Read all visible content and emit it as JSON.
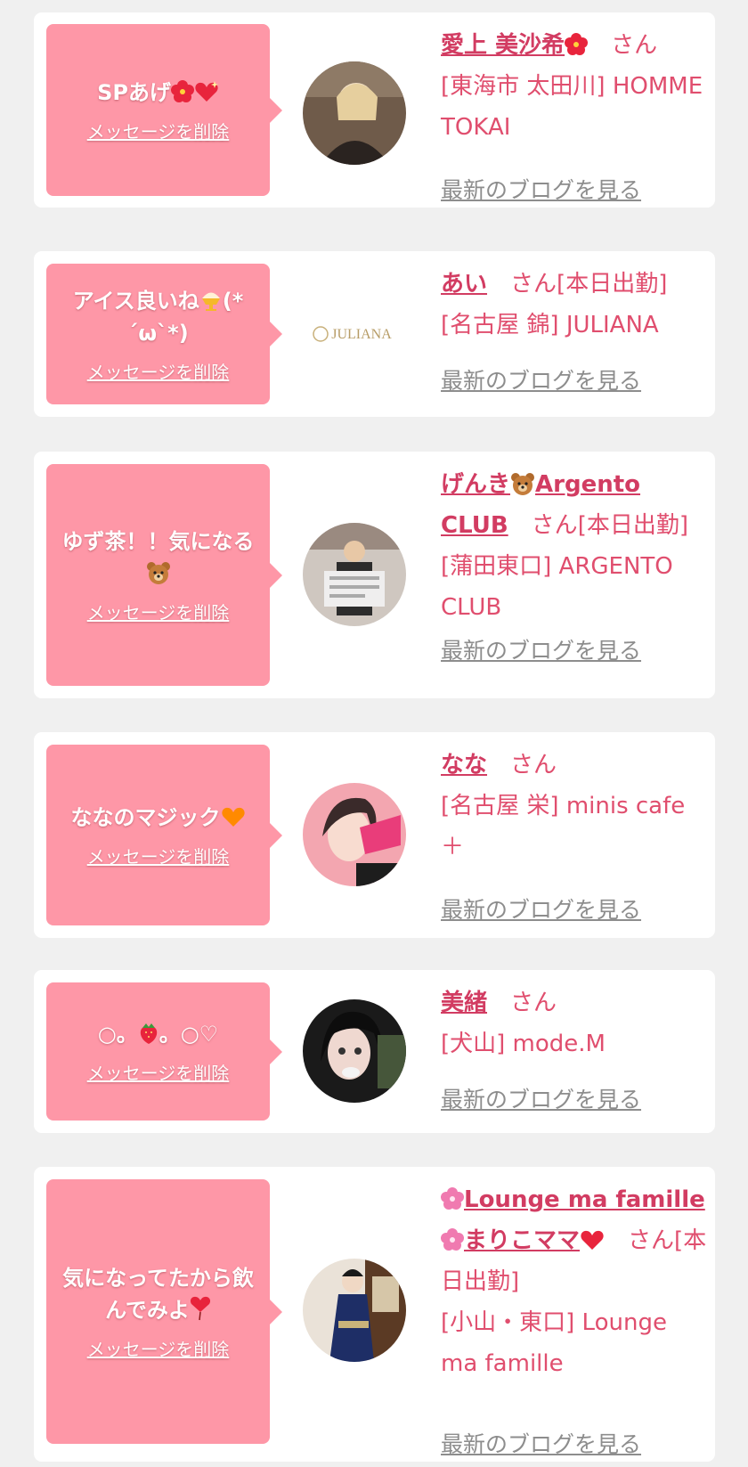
{
  "colors": {
    "bubble": "#fe97a7",
    "accent": "#e04e6e",
    "link_gray": "#8d8d8d",
    "background": "#f0f0f0"
  },
  "entries": [
    {
      "message": "SPあげ",
      "message_icons": [
        "hibiscus-icon",
        "sparkling-heart-icon"
      ],
      "delete_label": "メッセージを削除",
      "name": "愛上 美沙希",
      "name_icons": [
        "hibiscus-icon"
      ],
      "honorific": "さん",
      "status": "",
      "shop": "[東海市 太田川] HOMME TOKAI",
      "blog_label": "最新のブログを見る",
      "avatar": "photo-avatar-blonde-woman"
    },
    {
      "message": "アイス良いね",
      "message_suffix": "(*´ω`*)",
      "message_icons": [
        "ice-cream-icon"
      ],
      "delete_label": "メッセージを削除",
      "name": "あい",
      "name_icons": [],
      "honorific": "さん",
      "status": "[本日出勤]",
      "shop": "[名古屋 錦] JULIANA",
      "blog_label": "最新のブログを見る",
      "avatar": "logo-avatar",
      "avatar_text": "JULIANA"
    },
    {
      "message": "ゆず茶！！気になる",
      "message_icons": [
        "bear-icon"
      ],
      "delete_label": "メッセージを削除",
      "name_prefix": "げんき",
      "name_suffix": "Argento CLUB",
      "name_icons": [
        "bear-icon"
      ],
      "honorific": "さん",
      "status": "[本日出勤]",
      "shop": "[蒲田東口] ARGENTO CLUB",
      "blog_label": "最新のブログを見る",
      "avatar": "photo-avatar-man-newspaper"
    },
    {
      "message": "ななのマジック",
      "message_icons": [
        "orange-heart-icon"
      ],
      "delete_label": "メッセージを削除",
      "name": "なな",
      "name_icons": [],
      "honorific": "さん",
      "status": "",
      "shop": "[名古屋 栄] minis cafe ＋",
      "blog_label": "最新のブログを見る",
      "avatar": "photo-avatar-woman-pink"
    },
    {
      "message_prefix": "○。",
      "message_suffix": "。○♡",
      "message_icons": [
        "strawberry-icon"
      ],
      "delete_label": "メッセージを削除",
      "name": "美緒",
      "name_icons": [],
      "honorific": "さん",
      "status": "",
      "shop": "[犬山] mode.M",
      "blog_label": "最新のブログを見る",
      "avatar": "photo-avatar-dark-hair"
    },
    {
      "message": "気になってたから飲んでみよ",
      "message_icons": [
        "balloon-heart-icon"
      ],
      "delete_label": "メッセージを削除",
      "name_part1": "Lounge ma famille",
      "name_part2": "まりこママ",
      "name_icons": [
        "sakura-icon",
        "sakura-icon",
        "red-heart-icon"
      ],
      "honorific": "さん",
      "status": "[本日出勤]",
      "shop": "[小山・東口] Lounge ma famille",
      "blog_label": "最新のブログを見る",
      "avatar": "photo-avatar-kimono-woman"
    }
  ]
}
